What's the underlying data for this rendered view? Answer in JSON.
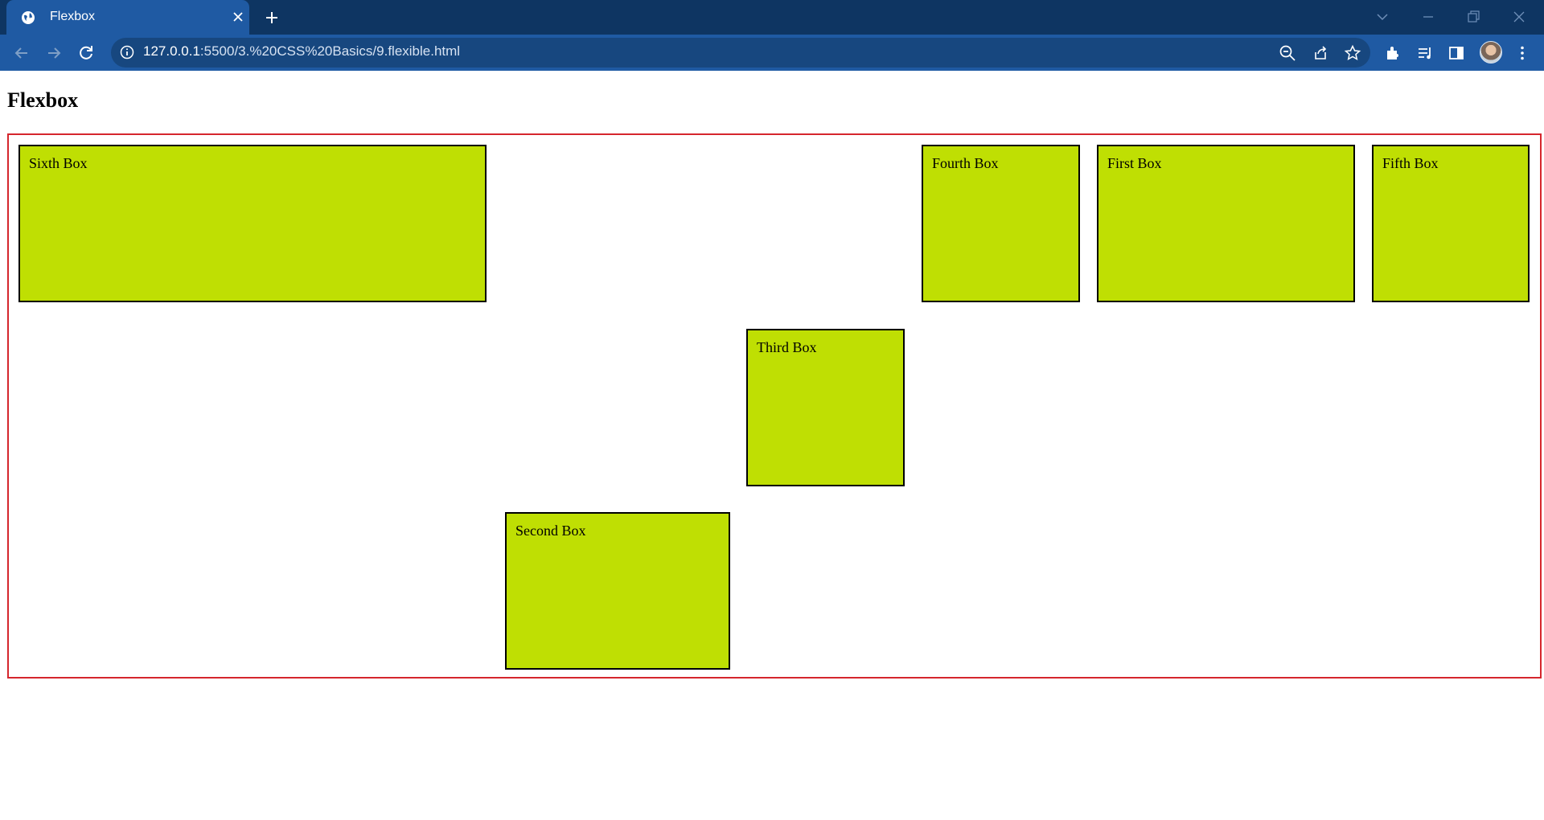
{
  "browser": {
    "tab": {
      "title": "Flexbox",
      "favicon": "globe-icon",
      "close_icon": "close-icon"
    },
    "new_tab_icon": "plus-icon",
    "window_controls": [
      "chevron-down-icon",
      "minimize-icon",
      "restore-icon",
      "close-window-icon"
    ],
    "nav": [
      "back-arrow-icon",
      "forward-arrow-icon",
      "reload-icon"
    ],
    "address": {
      "host": "127.0.0.1",
      "rest": ":5500/3.%20CSS%20Basics/9.flexible.html"
    },
    "omnibox_icons": [
      "zoom-out-icon",
      "share-icon",
      "bookmark-star-icon"
    ],
    "toolbar_icons": [
      "extensions-puzzle-icon",
      "media-playlist-icon",
      "side-panel-icon",
      "avatar",
      "kebab-menu-icon"
    ],
    "colors": {
      "tabbar_bg": "#0e3562",
      "toolbar_bg": "#1f5aa3",
      "omnibox_bg": "#17477f"
    }
  },
  "page": {
    "heading": "Flexbox",
    "container_border_color": "#d5262d",
    "box_color": "#bfdf03",
    "boxes": [
      {
        "label": "Sixth Box"
      },
      {
        "label": "Fourth Box"
      },
      {
        "label": "First Box"
      },
      {
        "label": "Fifth Box"
      },
      {
        "label": "Third Box"
      },
      {
        "label": "Second Box"
      }
    ]
  }
}
